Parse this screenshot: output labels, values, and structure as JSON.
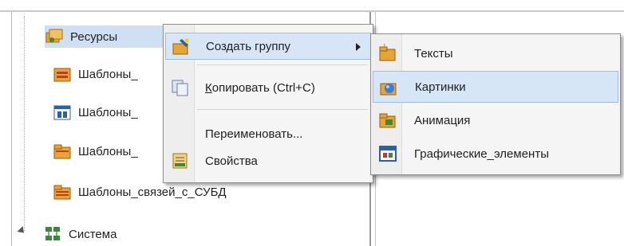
{
  "tree": {
    "items": [
      {
        "label": "Ресурсы",
        "icon": "resources-folder-icon"
      },
      {
        "label": "Шаблоны_",
        "icon": "templates-folder-icon"
      },
      {
        "label": "Шаблоны_",
        "icon": "window-templates-icon"
      },
      {
        "label": "Шаблоны_",
        "icon": "templates-folder-icon"
      },
      {
        "label": "Шаблоны_связей_с_СУБД",
        "icon": "templates-folder-icon"
      },
      {
        "label": "Система",
        "icon": "system-network-icon"
      }
    ]
  },
  "context_menu": {
    "items": [
      {
        "label": "Создать группу",
        "icon": "create-group-icon"
      },
      {
        "label": "Копировать (Ctrl+C)",
        "underline_char": "К",
        "rest": "опировать (Ctrl+C)",
        "icon": "copy-icon"
      },
      {
        "label": "Переименовать...",
        "icon": ""
      },
      {
        "label": "Свойства",
        "icon": "properties-icon"
      }
    ]
  },
  "submenu": {
    "items": [
      {
        "label": "Тексты",
        "icon": "texts-folder-icon"
      },
      {
        "label": "Картинки",
        "icon": "pictures-folder-icon"
      },
      {
        "label": "Анимация",
        "icon": "animation-folder-icon"
      },
      {
        "label": "Графические_элементы",
        "icon": "graphic-elements-icon"
      }
    ]
  },
  "colors": {
    "selection": "#cfe0f5",
    "menu_highlight": "#d7e6f7",
    "folder": "#e8a534"
  }
}
